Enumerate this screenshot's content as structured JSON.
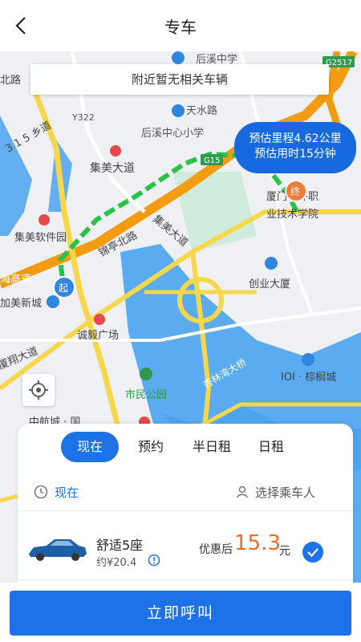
{
  "header": {
    "title": "专车"
  },
  "map": {
    "notice": "附近暂无相关车辆",
    "estimate_distance": "预估里程4.62公里",
    "estimate_time": "预估用时15分钟",
    "start_marker": "起",
    "end_marker": "终",
    "labels": {
      "houxi_middle": "后溪中学",
      "tianshui_rd": "天水路",
      "houxi_center_primary": "后溪中心小学",
      "jimei_ave": "集美大道",
      "jimei_ave2": "集美大道",
      "xiamen_vocational": "厦门软件职",
      "xiamen_vocational2": "业技术学院",
      "jimei_software_park": "集美软件园",
      "jinting_north": "锦亭北路",
      "chuangye": "创业大厦",
      "jimei_newcity": "加美新城",
      "chengyi": "诚毅广场",
      "xiangan_ave": "厦翔大道",
      "ioi": "IOI · 棕榈城",
      "civic_park": "市民公园",
      "xinglin_bridge": "杏林湾大桥",
      "zhonghang": "中航城 · 国",
      "road_315": "3 1 5 乡道",
      "haicang_hw": "海高速",
      "north_rd": "北路",
      "y322": "Y322",
      "g15": "G15",
      "g2517": "G2517"
    }
  },
  "panel": {
    "tabs": [
      "现在",
      "预约",
      "半日租",
      "日租"
    ],
    "active_tab": 0,
    "time_label": "现在",
    "passenger_label": "选择乘车人",
    "car": {
      "name": "舒适5座",
      "estimate": "约¥20.4",
      "price_prefix": "优惠后",
      "price": "15.3",
      "price_unit": "元",
      "selected": true
    }
  },
  "action": {
    "call_label": "立即呼叫"
  },
  "colors": {
    "accent": "#1e72e8",
    "price": "#f06a24",
    "route": "#2bc24a",
    "highway": "#f39c12",
    "water": "#4aa3f0"
  }
}
